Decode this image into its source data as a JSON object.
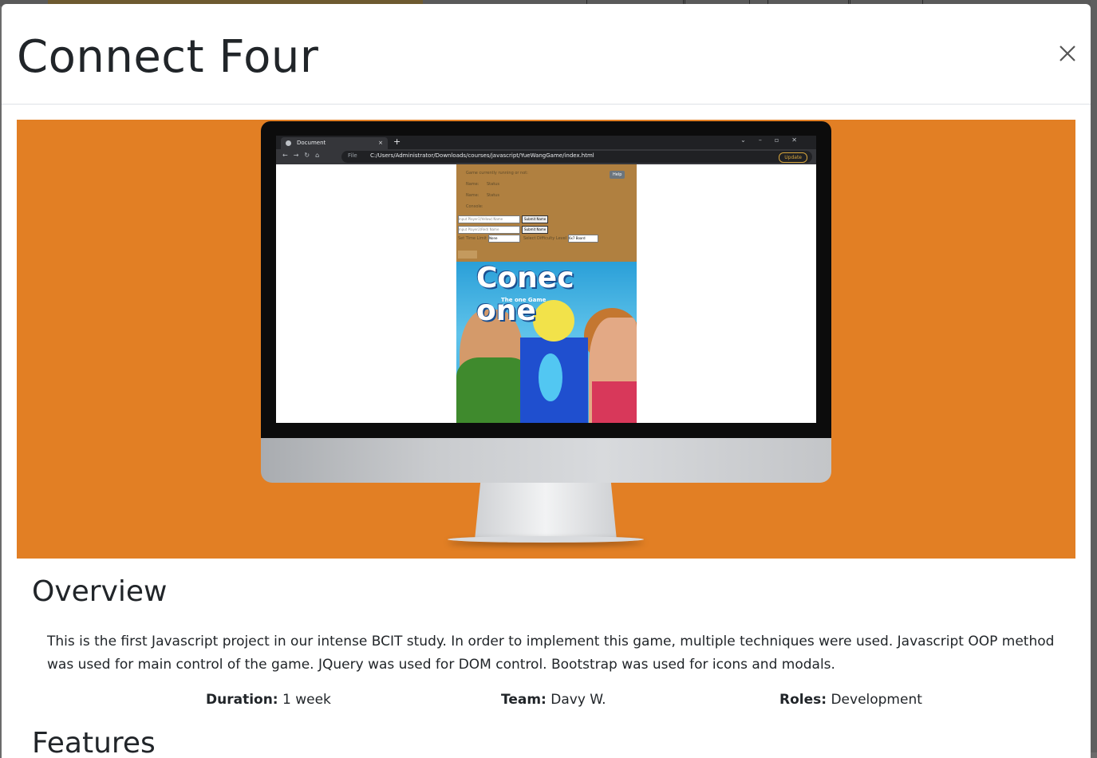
{
  "modal": {
    "title": "Connect Four",
    "close_label": "×"
  },
  "screenshot": {
    "tab_title": "Document",
    "tab_close": "×",
    "new_tab": "+",
    "url_prefix": "File",
    "url": "C:/Users/Administrator/Downloads/courses/javascript/YueWangGame/index.html",
    "update_label": "Update",
    "game": {
      "status_line": "Game currently running or not:",
      "name1": "Name:",
      "status1": "Status",
      "name2": "Name:",
      "status2": "Status",
      "console": "Console:",
      "help": "Help",
      "p1_placeholder": "Input Player1(Yellow) Name",
      "p2_placeholder": "Input Player2(Red) Name",
      "submit_label": "Submit Name",
      "time_limit_label": "Set Time Limit",
      "time_limit_value": "None",
      "difficulty_label": "Select Difficulty Level",
      "difficulty_value": "6x7 Board",
      "box_title": "Conec one",
      "box_subtitle": "The one Game"
    }
  },
  "overview": {
    "heading": "Overview",
    "text": "This is the first Javascript project in our intense BCIT study. In order to implement this game, multiple techniques were used. Javascript OOP method was used for main control of the game. JQuery was used for DOM control. Bootstrap was used for icons and modals."
  },
  "meta": {
    "duration_label": "Duration:",
    "duration_value": "1 week",
    "team_label": "Team:",
    "team_value": "Davy W.",
    "roles_label": "Roles:",
    "roles_value": "Development"
  },
  "features": {
    "heading": "Features"
  },
  "colors": {
    "hero_bg": "#e27f24",
    "text": "#212529"
  }
}
